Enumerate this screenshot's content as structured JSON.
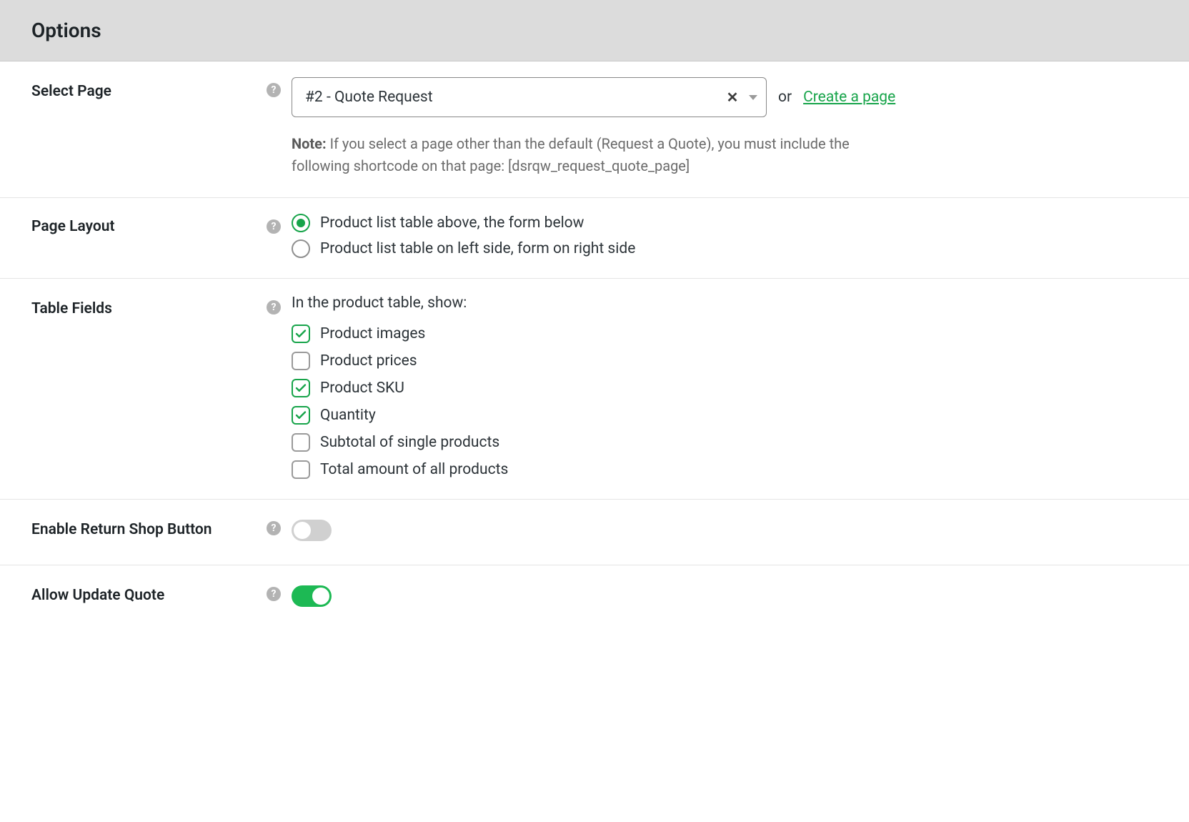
{
  "header": {
    "title": "Options"
  },
  "selectPage": {
    "label": "Select Page",
    "value": "#2 - Quote Request",
    "orText": "or",
    "createLinkText": "Create a page",
    "noteBold": "Note:",
    "noteText": " If you select a page other than the default (Request a Quote), you must include the following shortcode on that page: [dsrqw_request_quote_page]"
  },
  "pageLayout": {
    "label": "Page Layout",
    "options": [
      {
        "label": "Product list table above, the form below",
        "checked": true
      },
      {
        "label": "Product list table on left side, form on right side",
        "checked": false
      }
    ]
  },
  "tableFields": {
    "label": "Table Fields",
    "intro": "In the product table, show:",
    "options": [
      {
        "label": "Product images",
        "checked": true
      },
      {
        "label": "Product prices",
        "checked": false
      },
      {
        "label": "Product SKU",
        "checked": true
      },
      {
        "label": "Quantity",
        "checked": true
      },
      {
        "label": "Subtotal of single products",
        "checked": false
      },
      {
        "label": "Total amount of all products",
        "checked": false
      }
    ]
  },
  "returnShop": {
    "label": "Enable Return Shop Button",
    "value": false
  },
  "allowUpdate": {
    "label": "Allow Update Quote",
    "value": true
  }
}
